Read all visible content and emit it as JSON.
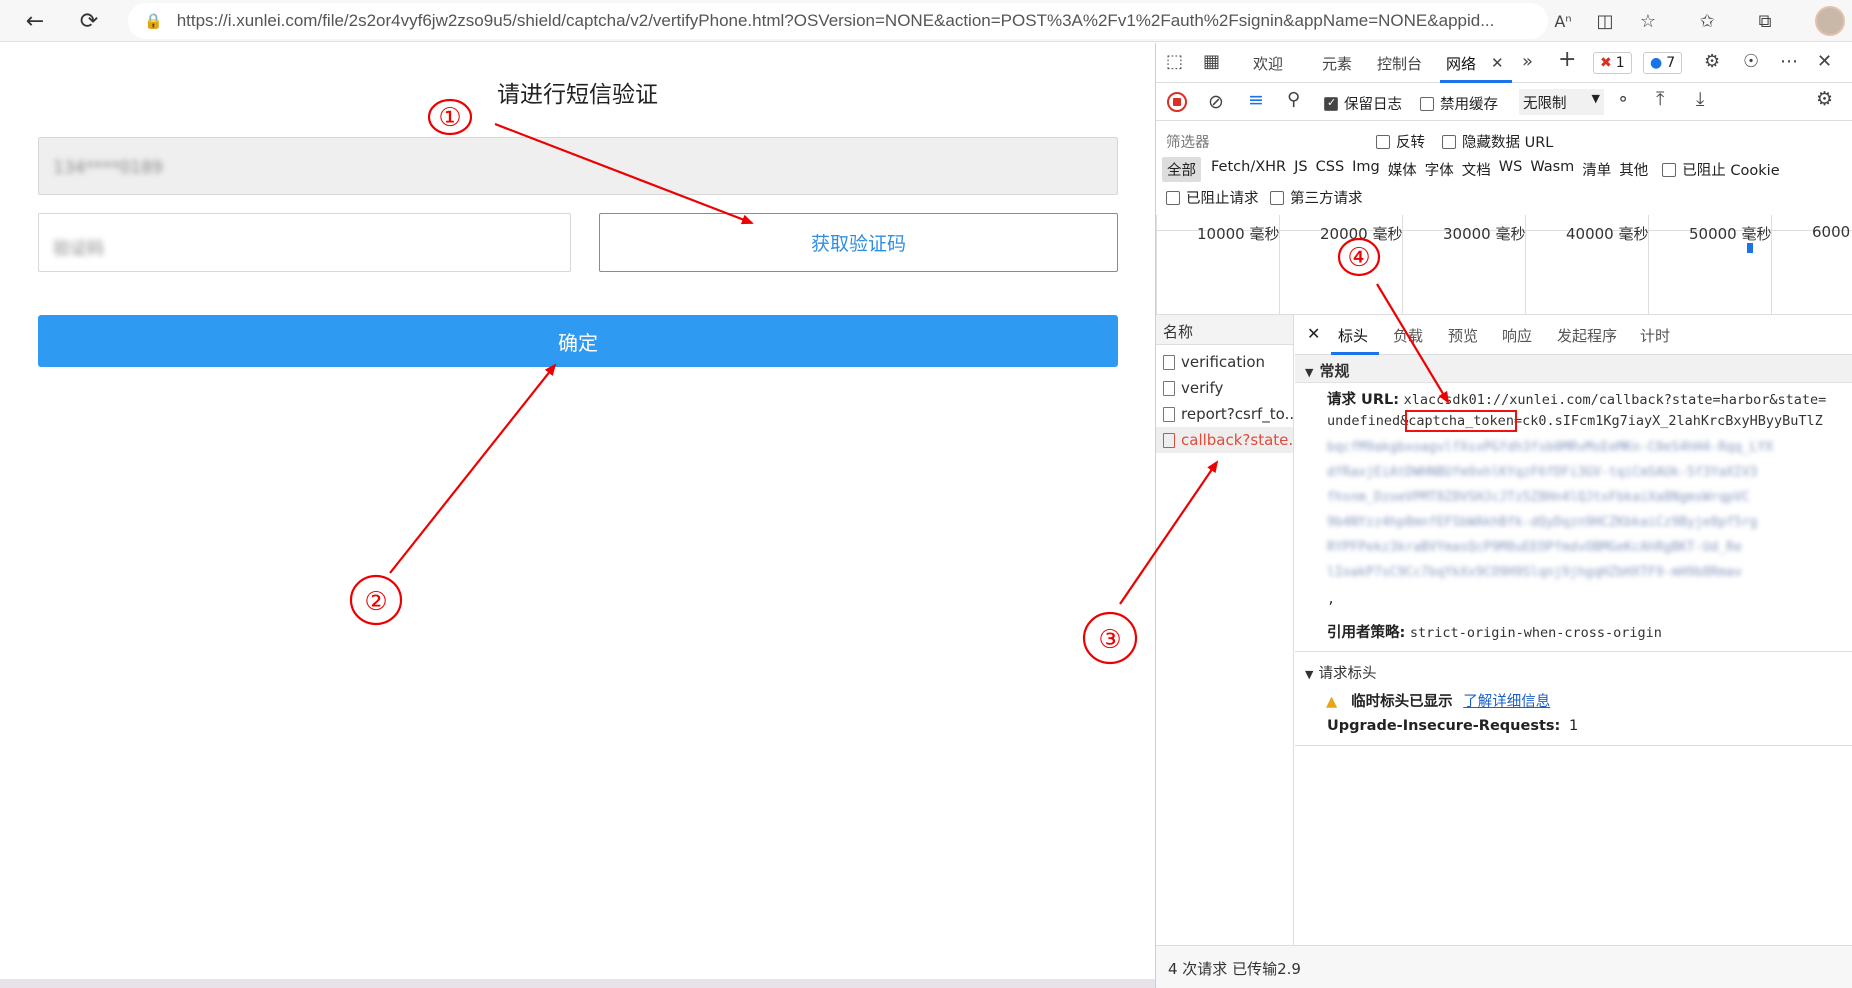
{
  "browser": {
    "url": "https://i.xunlei.com/file/2s2or4vyf6jw2zso9u5/shield/captcha/v2/vertifyPhone.html?OSVersion=NONE&action=POST%3A%2Fv1%2Fauth%2Fsignin&appName=NONE&appid...",
    "icons": [
      "back-icon",
      "refresh-icon",
      "lock-icon",
      "read-aloud-icon",
      "split-screen-icon",
      "add-favorite-icon",
      "favorites-icon",
      "collections-icon",
      "profile-avatar"
    ]
  },
  "page": {
    "title": "请进行短信验证",
    "phone_blurred": "134****0189",
    "code_blurred": "验证码",
    "get_code_label": "获取验证码",
    "confirm_label": "确定"
  },
  "devtools": {
    "tabs": {
      "welcome": "欢迎",
      "elements": "元素",
      "console": "控制台",
      "network": "网络"
    },
    "errors": "1",
    "messages": "7",
    "toolbar": {
      "preserve_log": "保留日志",
      "disable_cache": "禁用缓存",
      "throttle": "无限制"
    },
    "filter": {
      "placeholder": "筛选器",
      "invert": "反转",
      "hide_data_url": "隐藏数据 URL",
      "types": [
        "全部",
        "Fetch/XHR",
        "JS",
        "CSS",
        "Img",
        "媒体",
        "字体",
        "文档",
        "WS",
        "Wasm",
        "清单",
        "其他"
      ],
      "blocked_cookies": "已阻止 Cookie",
      "blocked_requests": "已阻止请求",
      "third_party": "第三方请求"
    },
    "timeline": [
      "10000 毫秒",
      "20000 毫秒",
      "30000 毫秒",
      "40000 毫秒",
      "50000 毫秒",
      "6000"
    ],
    "request_list": {
      "header": "名称",
      "items": [
        "verification",
        "verify",
        "report?csrf_to...",
        "callback?state..."
      ]
    },
    "detail_tabs": [
      "标头",
      "负载",
      "预览",
      "响应",
      "发起程序",
      "计时"
    ],
    "general": {
      "header": "常规",
      "url_label": "请求 URL:",
      "url_line1": "xlaccsdk01://xunlei.com/callback?state=harbor&state=",
      "url_line2_pre": "undefined&",
      "url_token_key": "captcha_token",
      "url_line2_post": "=ck0.sIFcm1Kg7iayX_2lahKrcBxyHByyBuTlZ",
      "blurred_lines": [
        "bqcfM9akgbxoagvlfXsxPGfdh3fsb0MRvMsEeMKn-C0eS4hH4-Rqq_LYX",
        "dfRaxjEiAtDWHNBUfm9xhlKYqzF6fDFi3GV-tqiCmSAUk-5f3YaXIV3",
        "fhsnm_DzoeVPMT8Z8VSHJcJTz5Z8Hn4lQJtxFbkaiXa8NgmsWrqpVC",
        "9b4NYzz4hp8mnfEFSbWAkhBfk-dQyDqzn9HCZKbkaiCz9Byje8pf5rg",
        "RYPFPekz3kraBVYmasQcP9M8uEEOPfmdvOBMGeKcAhRgBKT-Ud_Re",
        "lIoakP7sC9Cc7bqYkXx9CO9H9Slqnj9jhgqHZbHXTF9-mH9b8Rmav"
      ],
      "trailing": ",",
      "referrer_label": "引用者策略:",
      "referrer_value": "strict-origin-when-cross-origin"
    },
    "request_headers": {
      "header": "请求标头",
      "warning": "临时标头已显示",
      "learn_more": "了解详细信息",
      "upgrade_label": "Upgrade-Insecure-Requests:",
      "upgrade_value": "1"
    },
    "footer": "4 次请求   已传输2.9"
  },
  "annotations": [
    "①",
    "②",
    "③",
    "④"
  ]
}
